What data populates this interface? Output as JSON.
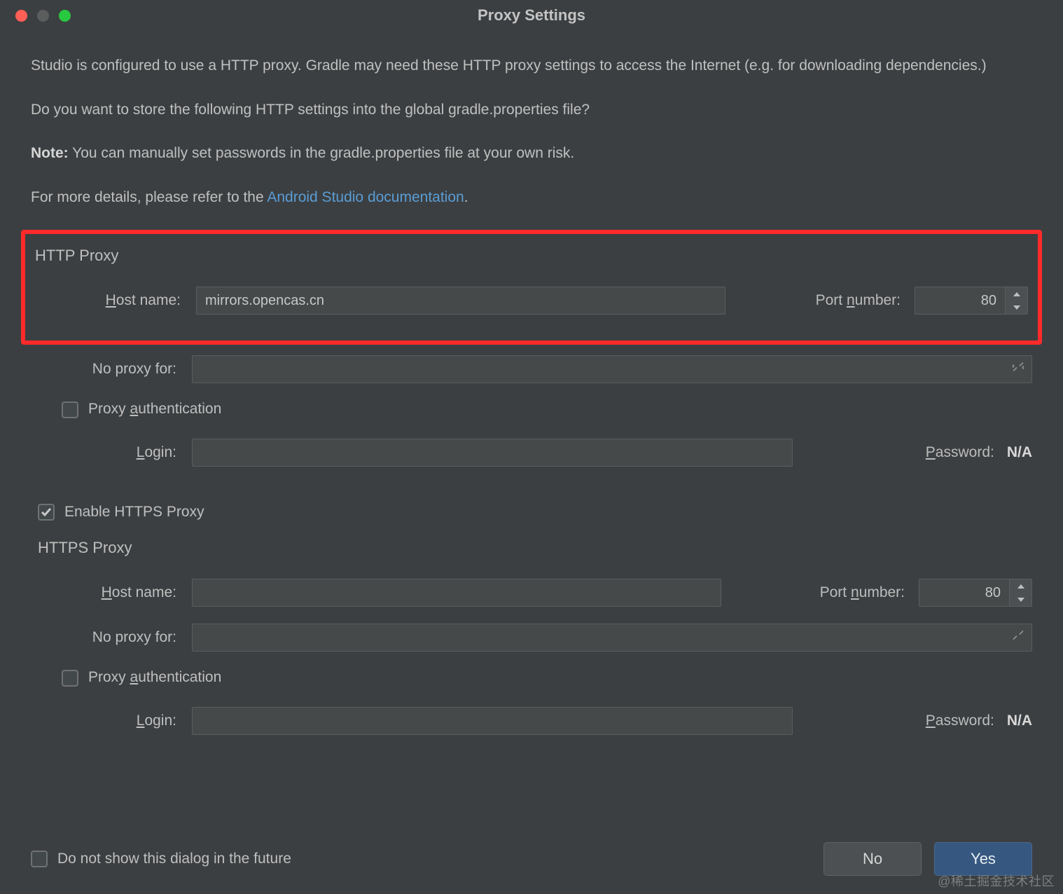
{
  "window": {
    "title": "Proxy Settings"
  },
  "intro": {
    "para1": "Studio is configured to use a HTTP proxy. Gradle may need these HTTP proxy settings to access the Internet (e.g. for downloading dependencies.)",
    "para2": "Do you want to store the following HTTP settings into the global gradle.properties file?",
    "note_label": "Note:",
    "note_rest": " You can manually set passwords in the gradle.properties file at your own risk.",
    "more_prefix": "For more details, please refer to the ",
    "more_link": "Android Studio documentation",
    "more_suffix": "."
  },
  "http": {
    "section": "HTTP Proxy",
    "host_label_pre": "H",
    "host_label_rest": "ost name:",
    "host_value": "mirrors.opencas.cn",
    "port_label_pre": "Port ",
    "port_label_mid": "n",
    "port_label_rest": "umber:",
    "port_value": "80",
    "noproxy_label": "No proxy for:",
    "noproxy_value": "",
    "auth_label_pre": "Proxy ",
    "auth_label_mid": "a",
    "auth_label_rest": "uthentication",
    "login_label_pre": "L",
    "login_label_rest": "ogin:",
    "login_value": "",
    "pw_label_pre": "P",
    "pw_label_rest": "assword:",
    "pw_value": "N/A"
  },
  "https_toggle": {
    "label": "Enable HTTPS Proxy"
  },
  "https": {
    "section": "HTTPS Proxy",
    "host_label_pre": "H",
    "host_label_rest": "ost name:",
    "host_value": "",
    "port_label_pre": "Port ",
    "port_label_mid": "n",
    "port_label_rest": "umber:",
    "port_value": "80",
    "noproxy_label": "No proxy for:",
    "noproxy_value": "",
    "auth_label_pre": "Proxy ",
    "auth_label_mid": "a",
    "auth_label_rest": "uthentication",
    "login_label_pre": "L",
    "login_label_rest": "ogin:",
    "login_value": "",
    "pw_label_pre": "P",
    "pw_label_rest": "assword:",
    "pw_value": "N/A"
  },
  "footer": {
    "dont_show": "Do not show this dialog in the future",
    "no": "No",
    "yes": "Yes"
  },
  "watermark": "@稀土掘金技术社区"
}
